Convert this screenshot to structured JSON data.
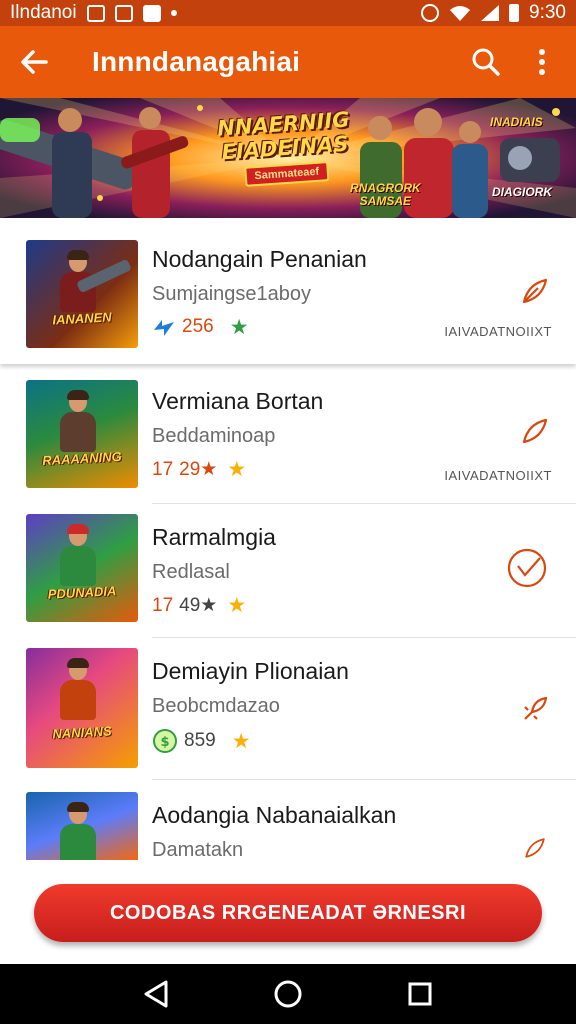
{
  "status_bar": {
    "carrier": "Ilndanoi",
    "time": "9:30"
  },
  "app_bar": {
    "title": "Innndanagahiai",
    "back_icon": "arrow-back-icon",
    "search_icon": "search-icon",
    "menu_icon": "more-vert-icon"
  },
  "banner": {
    "title_line1": "NNAERNIIG",
    "title_line2": "EIADEINAS",
    "subtitle": "Sammateaef",
    "badge_right_top": "INADIAIS",
    "badge_center": "RNAGRORK",
    "badge_center_sub": "SAMSAE",
    "badge_right_bottom": "DIAGIORK"
  },
  "apps": [
    {
      "name": "Nodangain Penanian",
      "developer": "Sumjaingse1aboy",
      "count": "256",
      "count_icon": "bolt-icon",
      "star_color": "#2f9e44",
      "tag": "IAIVADATNOIIXT",
      "thumb_label": "IANANEN",
      "action_icon": "feather-icon"
    },
    {
      "name": "Vermiana Bortan",
      "developer": "Beddaminoap",
      "count": "29★",
      "count_prefix": "17",
      "count_icon": "bolt-icon",
      "star_color": "#fab005",
      "tag": "IAIVADATNOIIXT",
      "thumb_label": "RAAAANING",
      "action_icon": "feather-icon"
    },
    {
      "name": "Rarmalmgia",
      "developer": "Redlasal",
      "count": "49★",
      "count_prefix": "17",
      "count_icon": "bolt-icon",
      "star_color": "#fab005",
      "tag": "",
      "thumb_label": "PDUNADIA",
      "action_icon": "circle-check-icon"
    },
    {
      "name": "Demiayin Plionaian",
      "developer": "Beobcmdazao",
      "count": "859",
      "count_icon": "coin-icon",
      "star_color": "#fab005",
      "tag": "",
      "thumb_label": "NANIANS",
      "action_icon": "rocket-icon"
    },
    {
      "name": "Aodangia Nabanaialkan",
      "developer": "Damatakn",
      "count": "",
      "tag": "",
      "thumb_label": "",
      "action_icon": "feather-icon"
    }
  ],
  "cta": {
    "label": "CODOBAS RRGENEADAT ƏRNESRI"
  },
  "nav": {
    "back_icon": "nav-back-icon",
    "home_icon": "nav-home-icon",
    "recents_icon": "nav-recents-icon"
  }
}
